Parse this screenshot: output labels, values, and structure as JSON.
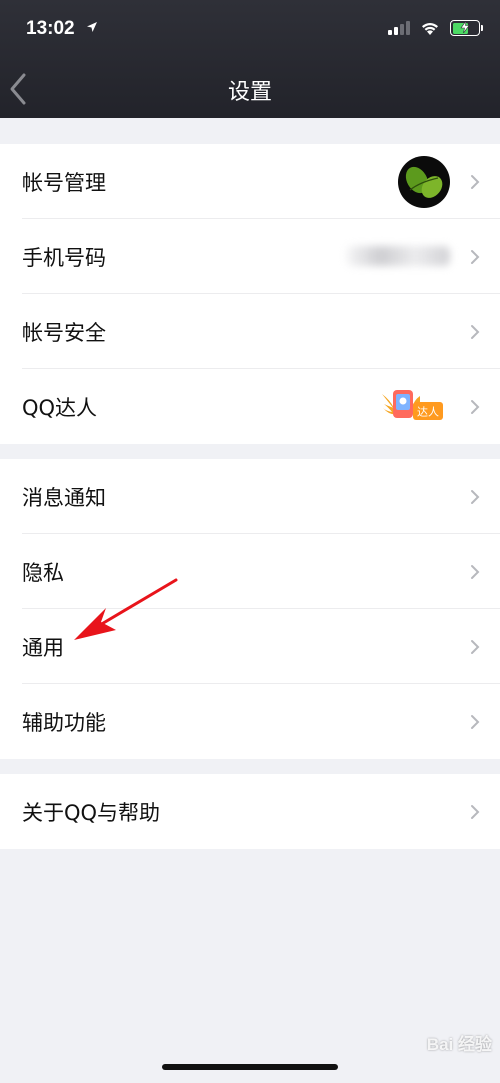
{
  "status_bar": {
    "time": "13:02"
  },
  "nav": {
    "title": "设置"
  },
  "groups": [
    {
      "items": [
        {
          "label": "帐号管理"
        },
        {
          "label": "手机号码"
        },
        {
          "label": "帐号安全"
        },
        {
          "label": "QQ达人"
        }
      ]
    },
    {
      "items": [
        {
          "label": "消息通知"
        },
        {
          "label": "隐私"
        },
        {
          "label": "通用"
        },
        {
          "label": "辅助功能"
        }
      ]
    },
    {
      "items": [
        {
          "label": "关于QQ与帮助"
        }
      ]
    }
  ],
  "badges": {
    "qq_talent": "达人"
  },
  "annotation": {
    "arrow_color": "#e8141b",
    "points_to": "通用"
  },
  "watermark": "Bai 经验",
  "colors": {
    "nav_bg": "#26272e",
    "page_bg": "#f0f1f5",
    "battery_green": "#4cd964"
  }
}
